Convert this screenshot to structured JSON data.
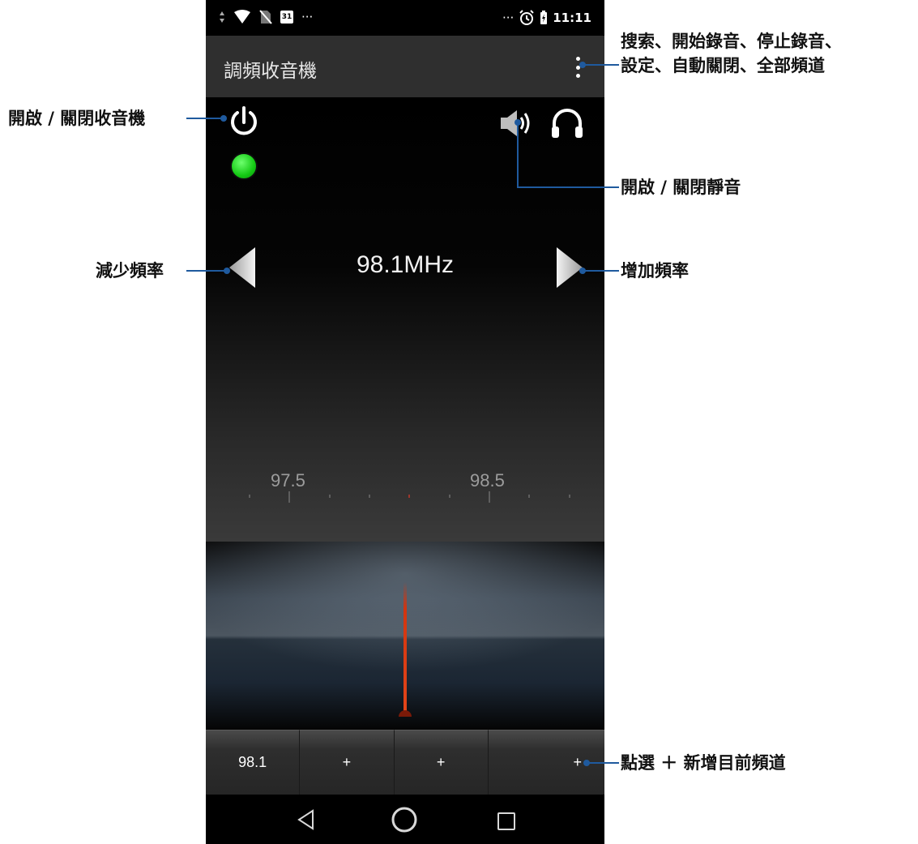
{
  "status_bar": {
    "left_icons": [
      "data-arrows-icon",
      "wifi-icon",
      "no-sim-icon",
      "calendar-icon"
    ],
    "calendar_date": "31",
    "left_more": "···",
    "right_more": "···",
    "time": "11:11"
  },
  "app_bar": {
    "title": "調頻收音機",
    "overflow_icon": "more-vertical-icon"
  },
  "radio": {
    "frequency": "98.1MHz",
    "scale_labels": [
      "97.5",
      "98.5"
    ],
    "power_indicator_color": "#22cc22",
    "needle_color": "#d2340f"
  },
  "presets": [
    "98.1",
    "+",
    "+",
    "+"
  ],
  "callouts": {
    "menu": [
      "搜索、開始錄音、停止錄音、",
      "設定、自動關閉、全部頻道"
    ],
    "power": "開啟 / 關閉收音機",
    "mute": "開啟 / 關閉靜音",
    "decrease": "減少頻率",
    "increase": "增加頻率",
    "add_preset": "點選 ＋ 新增目前頻道"
  },
  "leader_color": "#1f5a9e"
}
